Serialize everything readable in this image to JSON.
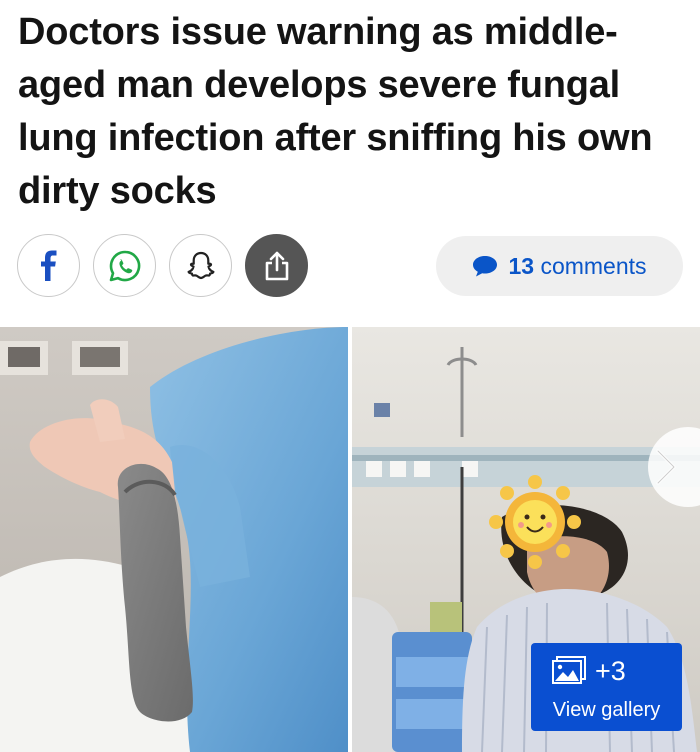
{
  "article": {
    "headline": "Doctors issue warning as middle-aged man develops severe fungal lung infection after sniffing his own dirty socks"
  },
  "share": {
    "facebook_icon": "facebook-icon",
    "whatsapp_icon": "whatsapp-icon",
    "snapchat_icon": "snapchat-icon",
    "share_icon": "share-icon"
  },
  "comments": {
    "count": "13",
    "label": "comments",
    "icon": "speech-bubble-icon",
    "color": "#0a55c8"
  },
  "gallery": {
    "extra_count": "+3",
    "view_label": "View gallery",
    "button_color": "#0a4fd1",
    "next_icon": "chevron-right-icon",
    "photo_left": "hand-holding-grey-sock",
    "photo_right": "patient-in-hospital-bed-face-covered-by-sun-emoji"
  }
}
